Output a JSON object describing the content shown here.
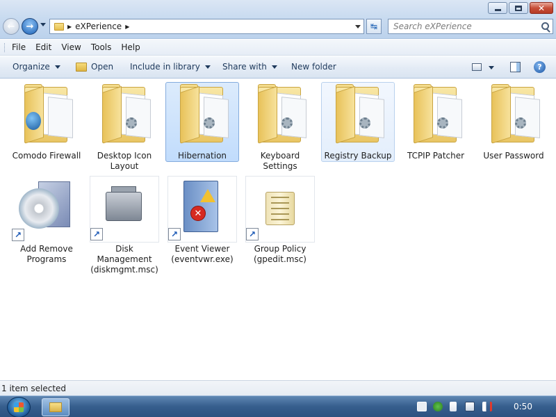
{
  "window": {
    "close_glyph": "✕"
  },
  "address": {
    "crumb": "eXPerience",
    "refresh_glyph": "↹"
  },
  "search": {
    "placeholder": "Search eXPerience"
  },
  "menu": {
    "items": [
      "File",
      "Edit",
      "View",
      "Tools",
      "Help"
    ]
  },
  "toolbar": {
    "organize": "Organize",
    "open": "Open",
    "include_in_library": "Include in library",
    "share_with": "Share with",
    "new_folder": "New folder",
    "help_glyph": "?"
  },
  "items": [
    {
      "label": "Comodo Firewall",
      "type": "folder"
    },
    {
      "label": "Desktop Icon Layout",
      "type": "folder"
    },
    {
      "label": "Hibernation",
      "type": "folder",
      "state": "selected"
    },
    {
      "label": "Keyboard Settings",
      "type": "folder"
    },
    {
      "label": "Registry Backup",
      "type": "folder",
      "state": "hover"
    },
    {
      "label": "TCPIP Patcher",
      "type": "folder"
    },
    {
      "label": "User Password",
      "type": "folder"
    },
    {
      "label": "Add Remove Programs",
      "type": "shortcut"
    },
    {
      "label": "Disk Management (diskmgmt.msc)",
      "type": "shortcut"
    },
    {
      "label": "Event Viewer (eventvwr.exe)",
      "type": "shortcut"
    },
    {
      "label": "Group Policy (gpedit.msc)",
      "type": "shortcut"
    }
  ],
  "shortcut_glyph": "↗",
  "error_glyph": "✕",
  "status": {
    "text": "1 item selected"
  },
  "taskbar": {
    "clock": "0:50"
  },
  "colors": {
    "selection": "#c1dcfc",
    "taskbar": "#365e8d"
  }
}
